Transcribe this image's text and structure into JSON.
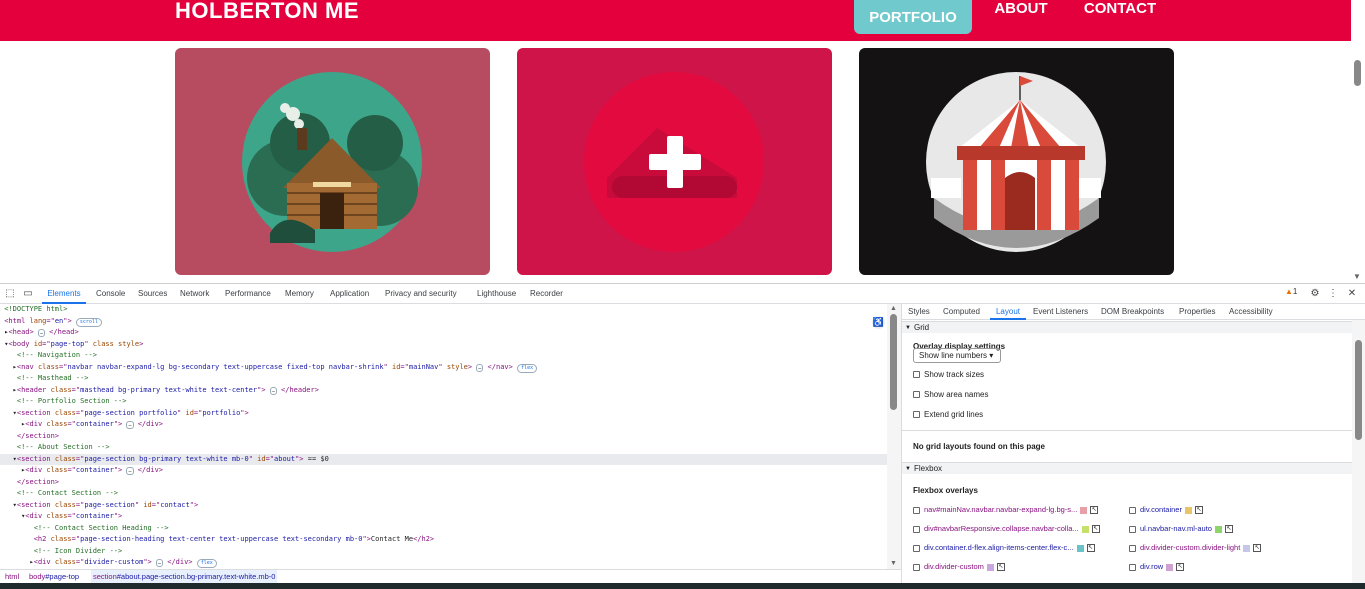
{
  "site": {
    "brand": "HOLBERTON ME",
    "nav": [
      "PORTFOLIO",
      "ABOUT",
      "CONTACT"
    ],
    "active_nav": "PORTFOLIO",
    "colors": {
      "navbar": "#e3003d",
      "active_nav_bg": "#70c9cc",
      "card1": "#b74c61",
      "card2": "#cf1449",
      "card3": "#141213"
    },
    "cards": [
      {
        "image": "log-cabin-icon"
      },
      {
        "image": "game-controller-plus-icon"
      },
      {
        "image": "circus-tent-icon"
      }
    ]
  },
  "devtools": {
    "main_tabs": [
      "Elements",
      "Console",
      "Sources",
      "Network",
      "Performance",
      "Memory",
      "Application",
      "Privacy and security",
      "Lighthouse",
      "Recorder"
    ],
    "active_tab": "Elements",
    "warning_count": "1",
    "code_lines": [
      {
        "parts": [
          [
            "c-comment",
            "<!DOCTYPE html>"
          ]
        ]
      },
      {
        "parts": [
          [
            "c-tag",
            "<html "
          ],
          [
            "c-attr",
            "lang"
          ],
          [
            "c-tag",
            "=\""
          ],
          [
            "c-val",
            "en"
          ],
          [
            "c-tag",
            "\">"
          ]
        ],
        "badge": "scroll"
      },
      {
        "parts": [
          [
            "c-text",
            "▸"
          ],
          [
            "c-tag",
            "<head>"
          ]
        ],
        "dots": true,
        "after": "</head>"
      },
      {
        "parts": [
          [
            "c-text",
            "▾"
          ],
          [
            "c-tag",
            "<body "
          ],
          [
            "c-attr",
            "id"
          ],
          [
            "c-tag",
            "=\""
          ],
          [
            "c-val",
            "page-top"
          ],
          [
            "c-tag",
            "\" "
          ],
          [
            "c-attr",
            "class style"
          ],
          [
            "c-tag",
            ">"
          ]
        ]
      },
      {
        "parts": [
          [
            "c-comment",
            "   <!-- Navigation -->"
          ]
        ]
      },
      {
        "parts": [
          [
            "c-text",
            "  ▸"
          ],
          [
            "c-tag",
            "<nav "
          ],
          [
            "c-attr",
            "class"
          ],
          [
            "c-tag",
            "=\""
          ],
          [
            "c-val",
            "navbar navbar-expand-lg bg-secondary text-uppercase fixed-top navbar-shrink"
          ],
          [
            "c-tag",
            "\" "
          ],
          [
            "c-attr",
            "id"
          ],
          [
            "c-tag",
            "=\""
          ],
          [
            "c-val",
            "mainNav"
          ],
          [
            "c-tag",
            "\" "
          ],
          [
            "c-attr",
            "style"
          ],
          [
            "c-tag",
            ">"
          ]
        ],
        "dots": true,
        "after": "</nav>",
        "badge": "flex"
      },
      {
        "parts": [
          [
            "c-comment",
            "   <!-- Masthead -->"
          ]
        ]
      },
      {
        "parts": [
          [
            "c-text",
            "  ▸"
          ],
          [
            "c-tag",
            "<header "
          ],
          [
            "c-attr",
            "class"
          ],
          [
            "c-tag",
            "=\""
          ],
          [
            "c-val",
            "masthead bg-primary text-white text-center"
          ],
          [
            "c-tag",
            "\">"
          ]
        ],
        "dots": true,
        "after": "</header>"
      },
      {
        "parts": [
          [
            "c-comment",
            "   <!-- Portfolio Section -->"
          ]
        ]
      },
      {
        "parts": [
          [
            "c-text",
            "  ▾"
          ],
          [
            "c-tag",
            "<section "
          ],
          [
            "c-attr",
            "class"
          ],
          [
            "c-tag",
            "=\""
          ],
          [
            "c-val",
            "page-section portfolio"
          ],
          [
            "c-tag",
            "\" "
          ],
          [
            "c-attr",
            "id"
          ],
          [
            "c-tag",
            "=\""
          ],
          [
            "c-val",
            "portfolio"
          ],
          [
            "c-tag",
            "\">"
          ]
        ]
      },
      {
        "parts": [
          [
            "c-text",
            "    ▸"
          ],
          [
            "c-tag",
            "<div "
          ],
          [
            "c-attr",
            "class"
          ],
          [
            "c-tag",
            "=\""
          ],
          [
            "c-val",
            "container"
          ],
          [
            "c-tag",
            "\">"
          ]
        ],
        "dots": true,
        "after": "</div>"
      },
      {
        "parts": [
          [
            "c-tag",
            "   </section>"
          ]
        ]
      },
      {
        "parts": [
          [
            "c-comment",
            "   <!-- About Section -->"
          ]
        ]
      },
      {
        "parts": [
          [
            "c-text",
            "  ▾"
          ],
          [
            "c-tag",
            "<section "
          ],
          [
            "c-attr",
            "class"
          ],
          [
            "c-tag",
            "=\""
          ],
          [
            "c-val",
            "page-section bg-primary text-white mb-0"
          ],
          [
            "c-tag",
            "\" "
          ],
          [
            "c-attr",
            "id"
          ],
          [
            "c-tag",
            "=\""
          ],
          [
            "c-val",
            "about"
          ],
          [
            "c-tag",
            "\">"
          ],
          [
            "c-text",
            " == $0"
          ]
        ],
        "selected": true
      },
      {
        "parts": [
          [
            "c-text",
            "    ▸"
          ],
          [
            "c-tag",
            "<div "
          ],
          [
            "c-attr",
            "class"
          ],
          [
            "c-tag",
            "=\""
          ],
          [
            "c-val",
            "container"
          ],
          [
            "c-tag",
            "\">"
          ]
        ],
        "dots": true,
        "after": "</div>"
      },
      {
        "parts": [
          [
            "c-tag",
            "   </section>"
          ]
        ]
      },
      {
        "parts": [
          [
            "c-comment",
            "   <!-- Contact Section -->"
          ]
        ]
      },
      {
        "parts": [
          [
            "c-text",
            "  ▾"
          ],
          [
            "c-tag",
            "<section "
          ],
          [
            "c-attr",
            "class"
          ],
          [
            "c-tag",
            "=\""
          ],
          [
            "c-val",
            "page-section"
          ],
          [
            "c-tag",
            "\" "
          ],
          [
            "c-attr",
            "id"
          ],
          [
            "c-tag",
            "=\""
          ],
          [
            "c-val",
            "contact"
          ],
          [
            "c-tag",
            "\">"
          ]
        ]
      },
      {
        "parts": [
          [
            "c-text",
            "    ▾"
          ],
          [
            "c-tag",
            "<div "
          ],
          [
            "c-attr",
            "class"
          ],
          [
            "c-tag",
            "=\""
          ],
          [
            "c-val",
            "container"
          ],
          [
            "c-tag",
            "\">"
          ]
        ]
      },
      {
        "parts": [
          [
            "c-comment",
            "       <!-- Contact Section Heading -->"
          ]
        ]
      },
      {
        "parts": [
          [
            "c-tag",
            "       <h2 "
          ],
          [
            "c-attr",
            "class"
          ],
          [
            "c-tag",
            "=\""
          ],
          [
            "c-val",
            "page-section-heading text-center text-uppercase text-secondary mb-0"
          ],
          [
            "c-tag",
            "\">"
          ],
          [
            "c-text",
            "Contact Me"
          ],
          [
            "c-tag",
            "</h2>"
          ]
        ]
      },
      {
        "parts": [
          [
            "c-comment",
            "       <!-- Icon Divider -->"
          ]
        ]
      },
      {
        "parts": [
          [
            "c-text",
            "      ▸"
          ],
          [
            "c-tag",
            "<div "
          ],
          [
            "c-attr",
            "class"
          ],
          [
            "c-tag",
            "=\""
          ],
          [
            "c-val",
            "divider-custom"
          ],
          [
            "c-tag",
            "\">"
          ]
        ],
        "dots": true,
        "after": "</div>",
        "badge": "flex"
      }
    ],
    "breadcrumbs": [
      {
        "tag": "html",
        "rest": ""
      },
      {
        "tag": "body",
        "rest": "#page-top"
      },
      {
        "tag": "section",
        "rest": "#about.page-section.bg-primary.text-white.mb-0"
      }
    ],
    "side_tabs": [
      "Styles",
      "Computed",
      "Layout",
      "Event Listeners",
      "DOM Breakpoints",
      "Properties",
      "Accessibility"
    ],
    "active_side_tab": "Layout",
    "layout": {
      "grid_title": "Grid",
      "overlay_title": "Overlay display settings",
      "overlay_select": "Show line numbers",
      "checkboxes": [
        "Show track sizes",
        "Show area names",
        "Extend grid lines"
      ],
      "no_grid": "No grid layouts found on this page",
      "flexbox_title": "Flexbox",
      "flex_overlays_title": "Flexbox overlays",
      "flex_items_left": [
        {
          "label": "nav#mainNav.navbar.navbar-expand-lg.bg-s...",
          "color": "#e8a0a8"
        },
        {
          "label": "div#navbarResponsive.collapse.navbar-colla...",
          "color": "#c6e06a"
        },
        {
          "label": "div.container.d-flex.align-items-center.flex-c...",
          "color": "#6ac3c6"
        },
        {
          "label": "div.divider-custom",
          "color": "#c9a6e0"
        }
      ],
      "flex_items_right": [
        {
          "label": "div.container",
          "color": "#e8c46a"
        },
        {
          "label": "ul.navbar-nav.ml-auto",
          "color": "#8fd36b"
        },
        {
          "label": "div.divider-custom.divider-light",
          "color": "#c6c6e8"
        },
        {
          "label": "div.row",
          "color": "#d0a0d0"
        }
      ]
    }
  }
}
